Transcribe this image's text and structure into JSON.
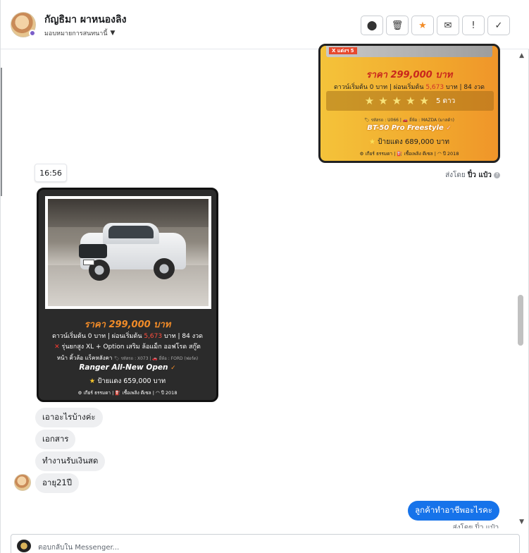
{
  "header": {
    "contact_name": "กัญธิมา ผาหนองลิง",
    "assign_label": "มอบหมายการสนทนานี้",
    "actions": [
      {
        "name": "spam-button",
        "glyph": "❗"
      },
      {
        "name": "delete-button",
        "glyph": "🗑"
      },
      {
        "name": "star-button",
        "glyph": "★"
      },
      {
        "name": "mark-unread-button",
        "glyph": "✉"
      },
      {
        "name": "follow-up-button",
        "glyph": "!"
      },
      {
        "name": "done-button",
        "glyph": "✓"
      }
    ]
  },
  "card_top": {
    "tag": "X แต่งฯ 5",
    "price": "ราคา 299,000 บาท",
    "finance_pre": "ดาวน์เริ่มต้น 0 บาท | ผ่อนเริ่มต้น ",
    "finance_amount": "5,673",
    "finance_post": " บาท | 84 งวด",
    "stars_label": "5 ดาว",
    "code_line": "🏷 รหัสรถ : U066 | 🚗 ยี่ห้อ : MAZDA (มาสด้า)",
    "model": "BT-50 Pro Freestyle",
    "red_plate": "ป้ายแดง 689,000 บาท",
    "footer": "⚙ เกียร์ ธรรมดา | ⛽ เชื้อเพลิง ดีเซล | ◠ ปี 2018"
  },
  "sent_by": {
    "prefix": "ส่งโดย ",
    "name": "ปิ๋ว แป๋ว"
  },
  "time_chip": "16:56",
  "card_dark": {
    "plate": "ยท 3915",
    "price": "ราคา 299,000 บาท",
    "finance_pre": "ดาวน์เริ่มต้น 0 บาท | ผ่อนเริ่มต้น ",
    "finance_amount": "5,673",
    "finance_post": " บาท | 84 งวด",
    "features_1": "รุ่นยกสูง XL + Option เสริม ล้อแม็ก ออฟโรด สกู๊ต",
    "features_2": "หน้า คิ้วล้อ แร็คหลังคา",
    "code_small": "🏷 รหัสรถ : X073 | 🚗 ยี่ห้อ : FORD (ฟอร์ด)",
    "model": "Ranger All-New Open",
    "red_plate": "ป้ายแดง 659,000 บาท",
    "footer": "⚙ เกียร์ ธรรมดา | ⛽ เชื้อเพลิง ดีเซล | ◠ ปี 2018"
  },
  "messages_in": [
    "เอาอะไรบ้างค่ะ",
    "เอกสาร",
    "ทำงานรับเงินสด",
    "อายุ21ปี"
  ],
  "message_out": "ลูกค้าทำอาชีพอะไรคะ",
  "peek_text": "ส่งโดย ปิ๋ว แป๋ว",
  "composer": {
    "placeholder": "ตอบกลับใน Messenger..."
  }
}
